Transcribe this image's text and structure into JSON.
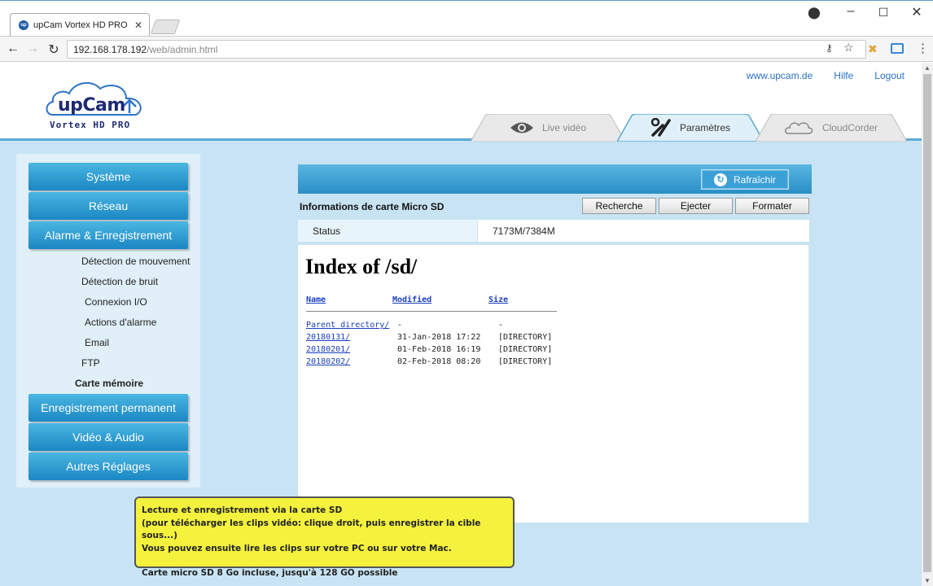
{
  "browser": {
    "tab_title": "upCam Vortex HD PRO",
    "tab_close": "✕",
    "url_host": "192.168.178.192",
    "url_path": "/web/admin.html"
  },
  "header": {
    "logo_text": "upCam",
    "logo_subtitle": "Vortex HD PRO",
    "links": {
      "website": "www.upcam.de",
      "help": "Hilfe",
      "logout": "Logout"
    },
    "tabs": {
      "live": "Live vidéo",
      "params": "Paramètres",
      "cloud": "CloudCorder"
    }
  },
  "sidebar": {
    "system": "Système",
    "network": "Réseau",
    "alarm": "Alarme & Enregistrement",
    "sub": {
      "motion": "Détection de mouvement",
      "noise": "Détection de bruit",
      "io": "Connexion I/O",
      "actions": "Actions d'alarme",
      "email": "Email",
      "ftp": "FTP",
      "memory": "Carte mémoire"
    },
    "permanent": "Enregistrement permanent",
    "video_audio": "Vidéo & Audio",
    "other": "Autres Réglages"
  },
  "main": {
    "refresh": "Rafraîchir",
    "sd_title": "Informations de carte Micro SD",
    "btn_search": "Recherche",
    "btn_eject": "Ejecter",
    "btn_format": "Formater",
    "status_label": "Status",
    "status_value": "7173M/7384M",
    "listing": {
      "title": "Index of /sd/",
      "col_name": "Name",
      "col_modified": "Modified",
      "col_size": "Size",
      "rows": [
        {
          "name": "Parent directory/",
          "modified": "-",
          "size": "-"
        },
        {
          "name": "20180131/",
          "modified": "31-Jan-2018 17:22",
          "size": "[DIRECTORY]"
        },
        {
          "name": "20180201/",
          "modified": "01-Feb-2018 16:19",
          "size": "[DIRECTORY]"
        },
        {
          "name": "20180202/",
          "modified": "02-Feb-2018 08:20",
          "size": "[DIRECTORY]"
        }
      ]
    }
  },
  "tooltip": {
    "line1": "Lecture et enregistrement via la carte SD",
    "line2": "(pour télécharger les clips vidéo: clique droit, puis enregistrer la cible sous...)",
    "line3": "Vous pouvez ensuite lire les clips sur votre PC ou sur votre Mac.",
    "line4": "Carte micro SD 8 Go incluse, jusqu'à 128 GO possible"
  },
  "colors": {
    "accent_blue": "#1b87c4",
    "page_bg": "#c8e4f4",
    "tooltip_bg": "#f4f23c"
  }
}
